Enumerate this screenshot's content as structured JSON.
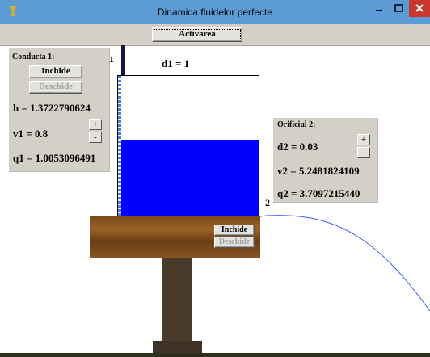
{
  "window": {
    "title": "Dinamica fluidelor perfecte",
    "icon": "app-icon",
    "controls": [
      "minimize-icon",
      "maximize-icon",
      "close-icon"
    ]
  },
  "toolbar": {
    "activate_label": "Activarea"
  },
  "conduct1": {
    "title": "Conducta 1:",
    "close_label": "Inchide",
    "open_label": "Deschide",
    "h_text": "h = 1.3722790624",
    "v1_text": "v1 = 0.8",
    "q1_text": "q1 = 1.0053096491",
    "plus": "+",
    "minus": "-"
  },
  "orifice2": {
    "title": "Orificiul 2:",
    "d2_text": "d2 = 0.03",
    "v2_text": "v2 = 5.2481824109",
    "q2_text": "q2 = 3.7097215440",
    "plus": "+",
    "minus": "-"
  },
  "scene": {
    "d1_text": "d1 = 1",
    "label_1": "1",
    "label_2": "2",
    "base_close_label": "Inchide",
    "base_open_label": "Deschide"
  },
  "colors": {
    "water": "#0000ff",
    "jet": "#3a5cff",
    "titlebar": "#5c9bd6"
  }
}
